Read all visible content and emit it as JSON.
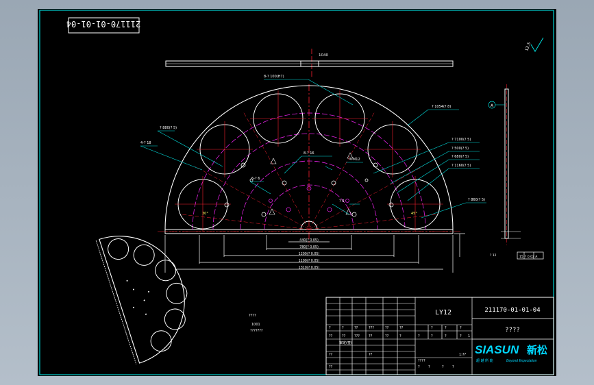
{
  "drawing": {
    "code_rotated": "211170-01-01-04",
    "top_dim": "1040",
    "roughness": "12.5",
    "sheet_note_1": "????",
    "sheet_note_2": "1001",
    "sheet_note_3": "???????",
    "labels": {
      "hole_pattern": "8-? 100(H7)",
      "outer_dia": "? 1054(? 8)",
      "dia_p1": "? 7100(? 5)",
      "dia_p2": "? 500(? 5)",
      "dia_p3": "? 680(? 5)",
      "dia_p4": "? 1160(? 5)",
      "dia_p5": "? 860(? 5)",
      "dia_p6": "? 880(? 5)",
      "hole_4": "4-? 18",
      "hole_8": "8-? 16",
      "thread_4": "4-M12",
      "thread_6": "6-? 6",
      "dim_left": "? 0",
      "angle_a": "30°",
      "angle_b": "45°",
      "datum": "A"
    },
    "bottom_dims": [
      "440(? 0.05)",
      "780(? 0.05)",
      "1200(? 0.05)",
      "1100(? 0.05)",
      "1310(? 0.05)"
    ],
    "right_dims": [
      "? 12",
      "15",
      "? 0.02 A"
    ]
  },
  "title_block": {
    "material": "LY12",
    "drawing_number": "211170-01-01-04",
    "part_name": "????",
    "brand_latin": "SIASUN",
    "brand_cn": "新松",
    "tagline_cn": "超 越 所 能",
    "tagline_en": "Beyond Expectation",
    "approval_label": "审定(签)",
    "row_cells": [
      "??",
      "??",
      "???",
      "??",
      "??",
      "?",
      "?"
    ],
    "left_cells": [
      "?",
      "?",
      "??",
      "???",
      "??",
      "??",
      "??",
      "??",
      "????",
      "??"
    ],
    "scale_cells": [
      "?",
      "?",
      "?",
      "?",
      "?",
      "?",
      "1"
    ],
    "lower_cells": [
      "?",
      "?",
      "?",
      "?",
      "1:??"
    ]
  },
  "colors": {
    "outline": "#ffffff",
    "centerline": "#ff2030",
    "hidden": "#e020e0",
    "dimension": "#00e0e0",
    "border": "#00d0d0",
    "label": "#ffffff"
  }
}
